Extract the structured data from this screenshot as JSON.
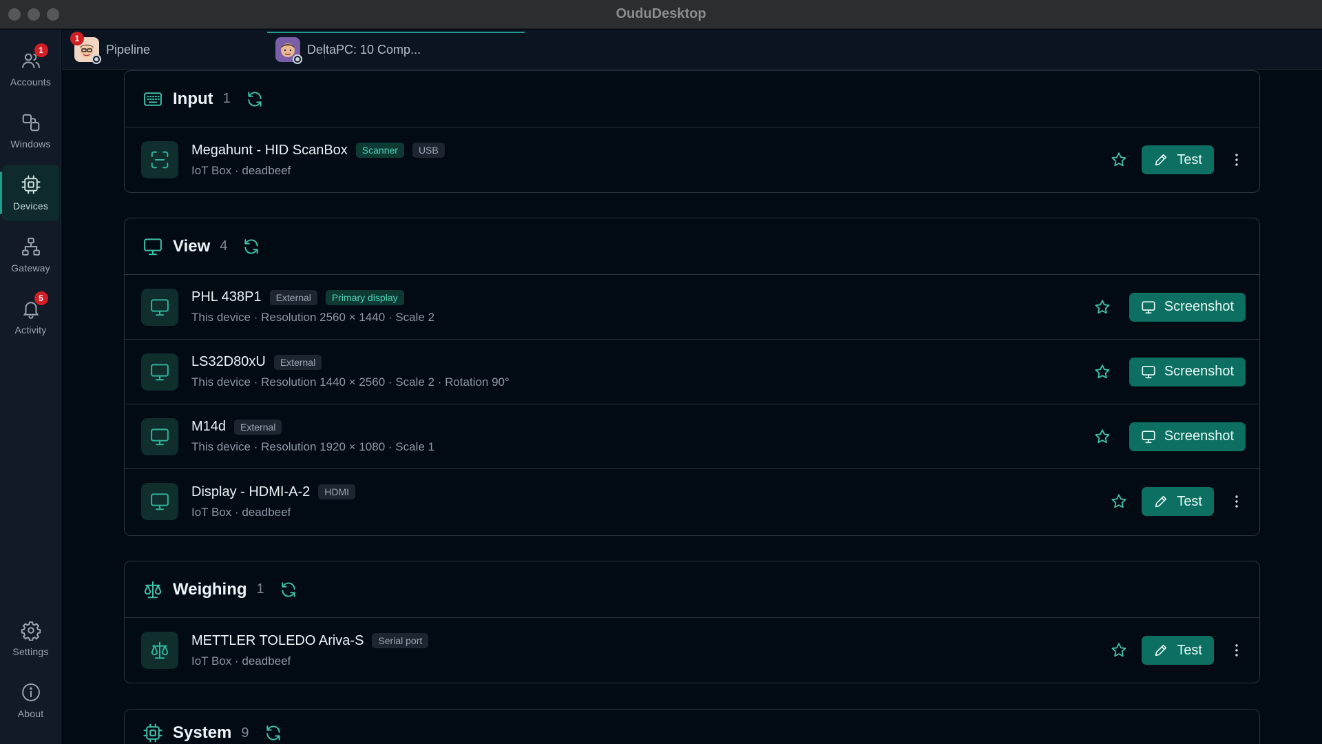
{
  "window": {
    "title": "OuduDesktop"
  },
  "sidebar": {
    "items": [
      {
        "id": "accounts",
        "label": "Accounts",
        "badge": "1",
        "icon": "users-icon"
      },
      {
        "id": "windows",
        "label": "Windows",
        "icon": "windows-icon"
      },
      {
        "id": "devices",
        "label": "Devices",
        "active": true,
        "icon": "chip-icon"
      },
      {
        "id": "gateway",
        "label": "Gateway",
        "icon": "network-icon"
      },
      {
        "id": "activity",
        "label": "Activity",
        "badge": "5",
        "icon": "bell-icon"
      },
      {
        "id": "settings",
        "label": "Settings",
        "icon": "gear-icon"
      },
      {
        "id": "about",
        "label": "About",
        "icon": "info-icon"
      }
    ]
  },
  "tabs": [
    {
      "label": "Pipeline",
      "badge": "1"
    },
    {
      "label": "DeltaPC: 10 Comp...",
      "active": true
    }
  ],
  "sections": {
    "input": {
      "title": "Input",
      "count": "1",
      "rows": [
        {
          "name": "Megahunt - HID ScanBox",
          "tags": [
            "Scanner",
            "USB"
          ],
          "sub": "IoT Box · deadbeef",
          "action": "Test"
        }
      ]
    },
    "view": {
      "title": "View",
      "count": "4",
      "rows": [
        {
          "name": "PHL 438P1",
          "tags": [
            "External",
            "Primary display"
          ],
          "sub": "This device · Resolution 2560 × 1440 · Scale 2",
          "action": "Screenshot"
        },
        {
          "name": "LS32D80xU",
          "tags": [
            "External"
          ],
          "sub": "This device · Resolution 1440 × 2560 · Scale 2 · Rotation 90°",
          "action": "Screenshot"
        },
        {
          "name": "M14d",
          "tags": [
            "External"
          ],
          "sub": "This device · Resolution 1920 × 1080 · Scale 1",
          "action": "Screenshot"
        },
        {
          "name": "Display - HDMI-A-2",
          "tags": [
            "HDMI"
          ],
          "sub": "IoT Box · deadbeef",
          "action": "Test"
        }
      ]
    },
    "weighing": {
      "title": "Weighing",
      "count": "1",
      "rows": [
        {
          "name": "METTLER TOLEDO Ariva-S",
          "tags": [
            "Serial port"
          ],
          "sub": "IoT Box · deadbeef",
          "action": "Test"
        }
      ]
    },
    "system": {
      "title": "System",
      "count": "9"
    }
  },
  "colors": {
    "accent": "#1f9e8d",
    "button": "#0c6f61",
    "badge": "#d11f26",
    "background": "#020a14"
  }
}
